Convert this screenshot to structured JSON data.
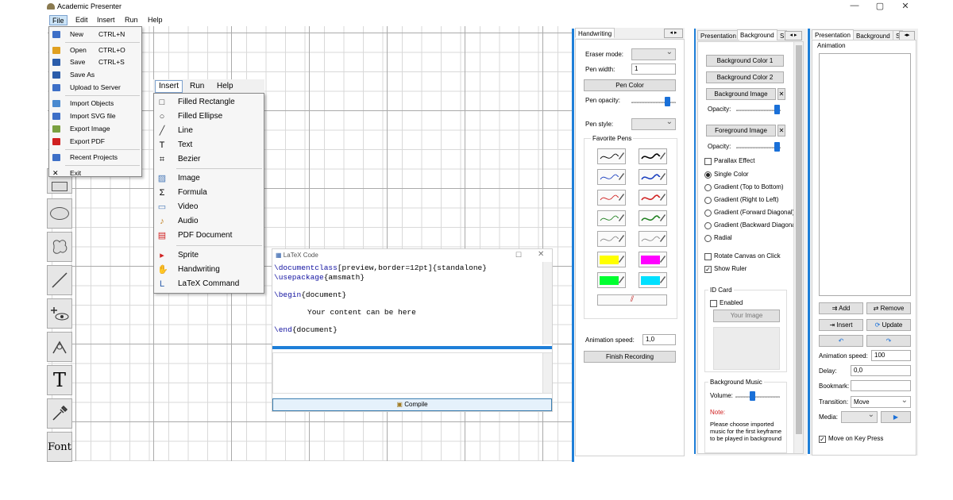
{
  "window": {
    "title": "Academic Presenter"
  },
  "menubar": [
    "File",
    "Edit",
    "Insert",
    "Run",
    "Help"
  ],
  "file_menu": [
    {
      "label": "New",
      "shortcut": "CTRL+N",
      "icon": "new-file-icon"
    },
    {
      "label": "Open",
      "shortcut": "CTRL+O",
      "icon": "folder-open-icon"
    },
    {
      "label": "Save",
      "shortcut": "CTRL+S",
      "icon": "save-icon"
    },
    {
      "label": "Save As",
      "shortcut": "",
      "icon": "save-as-icon"
    },
    {
      "label": "Upload to Server",
      "shortcut": "",
      "icon": "upload-icon"
    },
    {
      "label": "Import Objects",
      "shortcut": "",
      "icon": "import-objects-icon"
    },
    {
      "label": "Import SVG file",
      "shortcut": "",
      "icon": "import-svg-icon"
    },
    {
      "label": "Export Image",
      "shortcut": "",
      "icon": "export-image-icon"
    },
    {
      "label": "Export PDF",
      "shortcut": "",
      "icon": "pdf-icon"
    },
    {
      "label": "Recent Projects",
      "shortcut": "",
      "icon": "recent-icon"
    },
    {
      "label": "Exit",
      "shortcut": "",
      "icon": "close-icon"
    }
  ],
  "insert_menubar": [
    "Insert",
    "Run",
    "Help"
  ],
  "insert_menu": [
    {
      "label": "Filled Rectangle",
      "icon": "rectangle-icon"
    },
    {
      "label": "Filled Ellipse",
      "icon": "ellipse-icon"
    },
    {
      "label": "Line",
      "icon": "line-icon"
    },
    {
      "label": "Text",
      "icon": "text-icon"
    },
    {
      "label": "Bezier",
      "icon": "bezier-icon"
    },
    {
      "label": "Image",
      "icon": "image-icon"
    },
    {
      "label": "Formula",
      "icon": "sigma-icon"
    },
    {
      "label": "Video",
      "icon": "video-icon"
    },
    {
      "label": "Audio",
      "icon": "audio-icon"
    },
    {
      "label": "PDF Document",
      "icon": "pdf-icon"
    },
    {
      "label": "Sprite",
      "icon": "sprite-icon"
    },
    {
      "label": "Handwriting",
      "icon": "hand-icon"
    },
    {
      "label": "LaTeX Command",
      "icon": "latex-icon"
    }
  ],
  "tools": {
    "text_glyph": "T",
    "font_label": "Font"
  },
  "latex": {
    "title": "LaTeX Code",
    "line1_cmd": "\\documentclass",
    "line1_rest": "[preview,border=12pt]{standalone}",
    "line2_cmd": "\\usepackage",
    "line2_rest": "{amsmath}",
    "line3_cmd": "\\begin",
    "line3_rest": "{document}",
    "line4": "Your content can be here",
    "line5_cmd": "\\end",
    "line5_rest": "{document}",
    "compile": "Compile"
  },
  "handwriting": {
    "tab": "Handwriting",
    "eraser_mode": "Eraser mode:",
    "pen_width": "Pen width:",
    "pen_width_value": "1",
    "pen_color": "Pen Color",
    "pen_opacity": "Pen opacity:",
    "pen_style": "Pen style:",
    "favorite_pens": "Favorite Pens",
    "animation_speed": "Animation speed:",
    "animation_speed_value": "1,0",
    "finish_recording": "Finish Recording",
    "pen_colors": [
      "#000000",
      "#000000",
      "#1a3fbf",
      "#1a3fbf",
      "#d02020",
      "#d02020",
      "#208020",
      "#208020",
      "#888888",
      "#888888",
      "#ffff00",
      "#ff00ff",
      "#00ff30",
      "#00e0ff"
    ]
  },
  "background": {
    "tabs": [
      "Presentation",
      "Background",
      "S"
    ],
    "bg_color1": "Background Color 1",
    "bg_color2": "Background Color 2",
    "bg_image": "Background Image",
    "opacity": "Opacity:",
    "fg_image": "Foreground Image",
    "parallax": "Parallax Effect",
    "single_color": "Single Color",
    "grad1": "Gradient (Top to Bottom)",
    "grad2": "Gradient (Right to Left)",
    "grad3": "Gradient (Forward Diagonal)",
    "grad4": "Gradient (Backward Diagonal",
    "radial": "Radial",
    "rotate": "Rotate Canvas on Click",
    "ruler": "Show Ruler",
    "id_card": "ID Card",
    "enabled": "Enabled",
    "your_image": "Your Image",
    "bg_music": "Background Music",
    "volume": "Volume:",
    "note": "Note:",
    "note_text": "Please choose imported music for the first keyframe to be played in background"
  },
  "presentation": {
    "tabs": [
      "Presentation",
      "Background",
      "S"
    ],
    "animation": "Animation",
    "add": "Add",
    "remove": "Remove",
    "insert": "Insert",
    "update": "Update",
    "animation_speed": "Animation speed:",
    "animation_speed_value": "100",
    "delay": "Delay:",
    "delay_value": "0,0",
    "bookmark": "Bookmark:",
    "transition": "Transition:",
    "transition_value": "Move",
    "media": "Media:",
    "move_on_key": "Move on Key Press"
  }
}
